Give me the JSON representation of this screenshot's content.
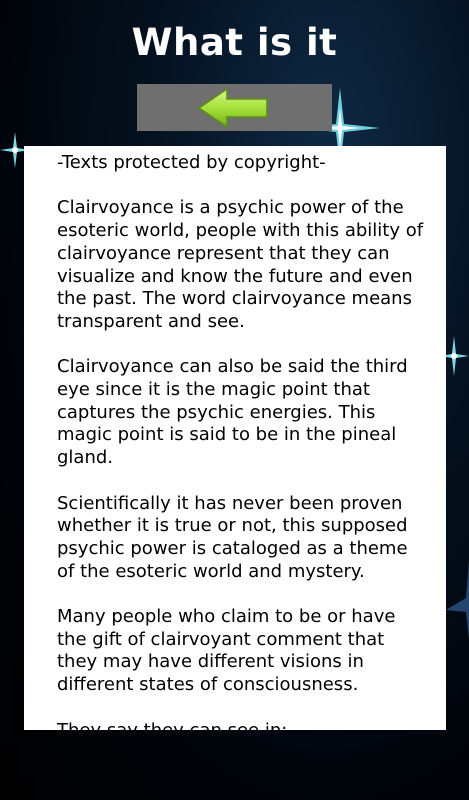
{
  "header": {
    "title": "What is it"
  },
  "toolbar": {
    "back_icon": "left-arrow-icon",
    "arrow_color": "#a6e13a"
  },
  "content": {
    "copyright": "-Texts protected by copyright-",
    "paragraphs": [
      " Clairvoyance is a psychic power of the esoteric world, people with this ability of clairvoyance represent that they can visualize and know the future and even the past. The word clairvoyance means transparent and see.",
      " Clairvoyance can also be said the third eye since it is the magic point that captures the psychic energies. This magic point is said to be in the pineal gland.",
      " Scientifically it has never been proven whether it is true or not, this supposed psychic power is cataloged as a theme of the esoteric world and mystery.",
      " Many people who claim to be or have the gift of clairvoyant comment that they may have different visions in different states of consciousness.",
      " They say they can see in:"
    ]
  },
  "background": {
    "decoration_icon": "sparkle-icon",
    "sparkle_color": "#9ff3ff"
  }
}
